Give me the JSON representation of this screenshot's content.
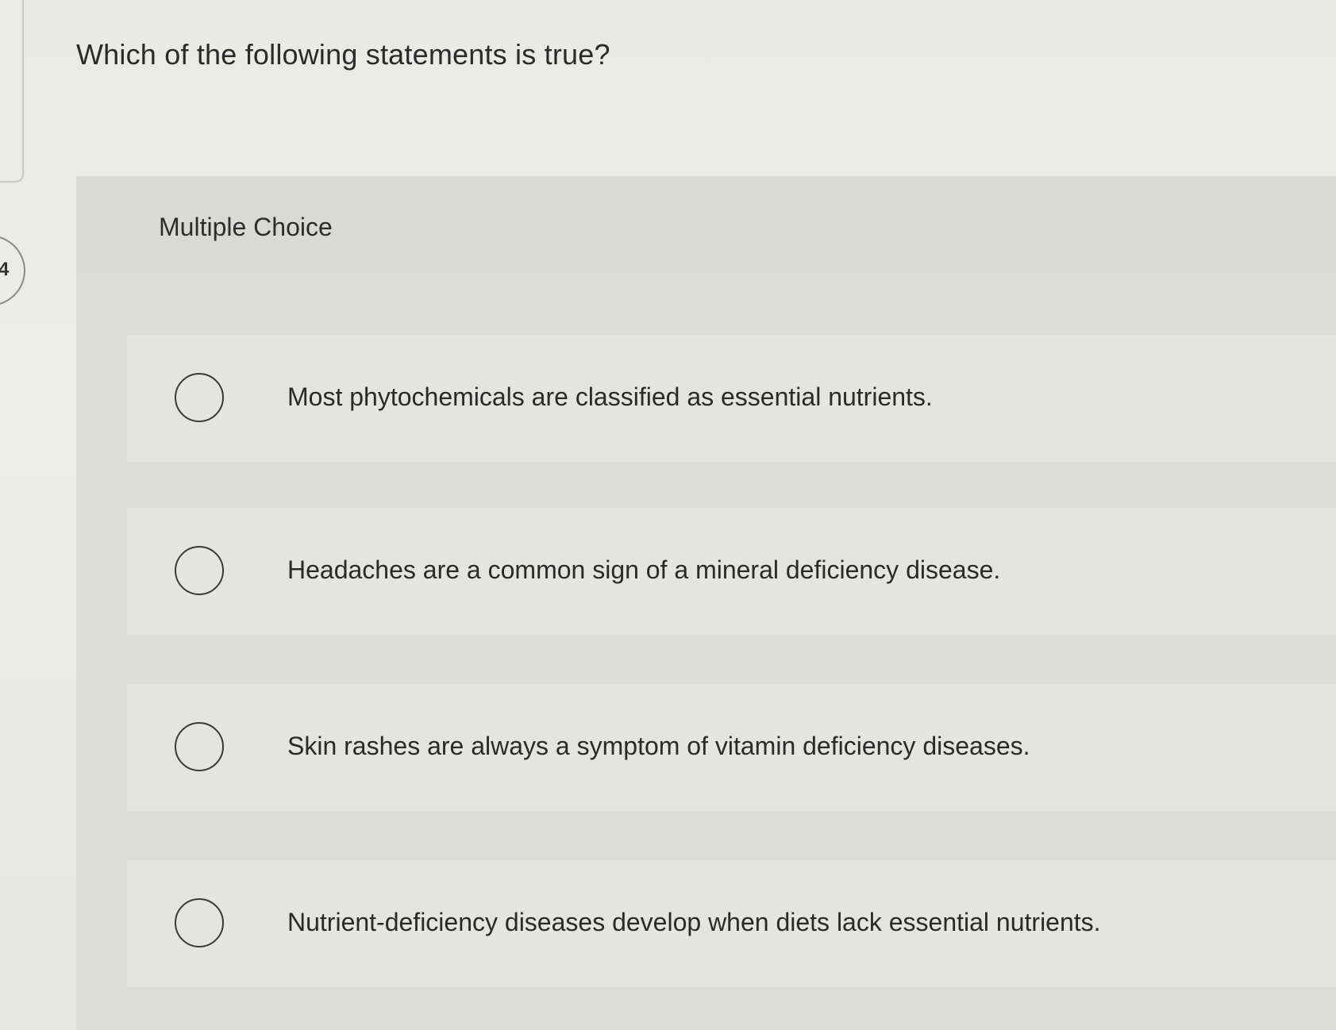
{
  "question": {
    "text": "Which of the following statements is true?"
  },
  "side": {
    "question_number_partial": "4"
  },
  "panel": {
    "type_label": "Multiple Choice",
    "choices": [
      {
        "label": "Most phytochemicals are classified as essential nutrients.",
        "selected": false
      },
      {
        "label": "Headaches are a common sign of a mineral deficiency disease.",
        "selected": false
      },
      {
        "label": "Skin rashes are always a symptom of vitamin deficiency diseases.",
        "selected": false
      },
      {
        "label": "Nutrient-deficiency diseases develop when diets lack essential nutrients.",
        "selected": false
      }
    ]
  }
}
